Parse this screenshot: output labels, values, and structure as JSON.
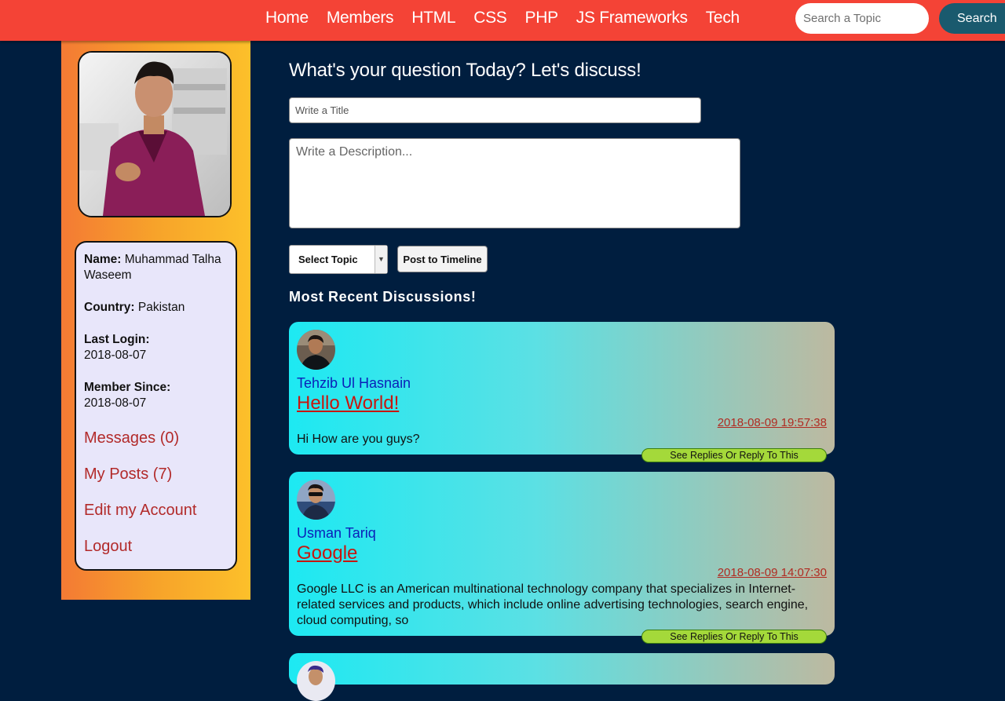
{
  "nav": {
    "links": [
      "Home",
      "Members",
      "HTML",
      "CSS",
      "PHP",
      "JS Frameworks",
      "Tech"
    ],
    "search_placeholder": "Search a Topic",
    "search_button": "Search"
  },
  "profile": {
    "name_label": "Name:",
    "name_value": "Muhammad Talha Waseem",
    "country_label": "Country:",
    "country_value": "Pakistan",
    "last_login_label": "Last Login:",
    "last_login_value": "2018-08-07",
    "member_since_label": "Member Since:",
    "member_since_value": "2018-08-07"
  },
  "sidebar_links": [
    "Messages (0)",
    "My Posts (7)",
    "Edit my Account",
    "Logout"
  ],
  "composer": {
    "heading": "What's your question Today? Let's discuss!",
    "title_placeholder": "Write a Title",
    "description_placeholder": "Write a Description...",
    "topic_select": "Select Topic",
    "post_button": "Post to Timeline"
  },
  "recent_heading": "Most Recent Discussions!",
  "posts": [
    {
      "author": "Tehzib Ul Hasnain",
      "title": "Hello World!",
      "time": "2018-08-09 19:57:38",
      "body": "Hi How are you guys?",
      "reply_label": "See Replies Or Reply To This"
    },
    {
      "author": "Usman Tariq",
      "title": "Google",
      "time": "2018-08-09 14:07:30",
      "body": "Google LLC is an American multinational technology company that specializes in Internet-related services and products, which include online advertising technologies, search engine, cloud computing, so",
      "reply_label": "See Replies Or Reply To This"
    }
  ],
  "colors": {
    "navbar": "#f44336",
    "page_background": "#001e3f",
    "link_red": "#b22a2a",
    "author_blue": "#0b1fb8",
    "reply_green": "#a4d93a"
  }
}
